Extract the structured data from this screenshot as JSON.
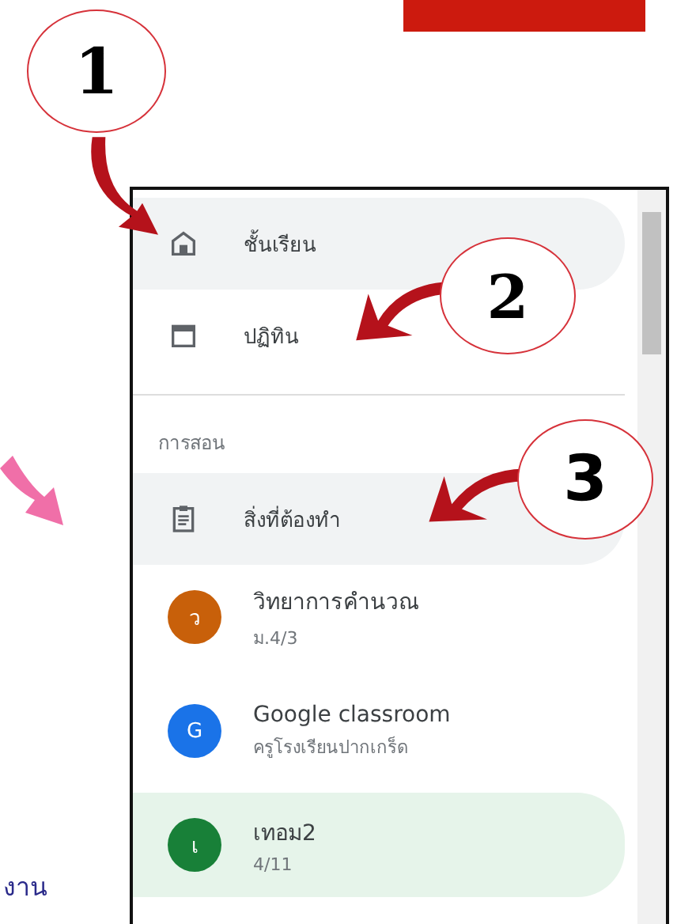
{
  "annotations": [
    {
      "label": "1"
    },
    {
      "label": "2"
    },
    {
      "label": "3"
    }
  ],
  "side_text": "งาน",
  "nav": [
    {
      "kind": "home",
      "label": "ชั้นเรียน",
      "selected": true
    },
    {
      "kind": "calendar",
      "label": "ปฏิทิน",
      "selected": false
    }
  ],
  "section": {
    "heading": "การสอน",
    "todo": {
      "label": "สิ่งที่ต้องทำ",
      "selected": true
    },
    "classes": [
      {
        "initial": "ว",
        "name": "วิทยาการคำนวณ",
        "subtitle": "ม.4/3",
        "color": "#c8600a",
        "selected": false
      },
      {
        "initial": "G",
        "name": "Google classroom",
        "subtitle": "ครูโรงเรียนปากเกร็ด",
        "color": "#1a73e8",
        "selected": false
      },
      {
        "initial": "เ",
        "name": "เทอม2",
        "subtitle": "4/11",
        "color": "#188038",
        "selected": true
      }
    ]
  }
}
